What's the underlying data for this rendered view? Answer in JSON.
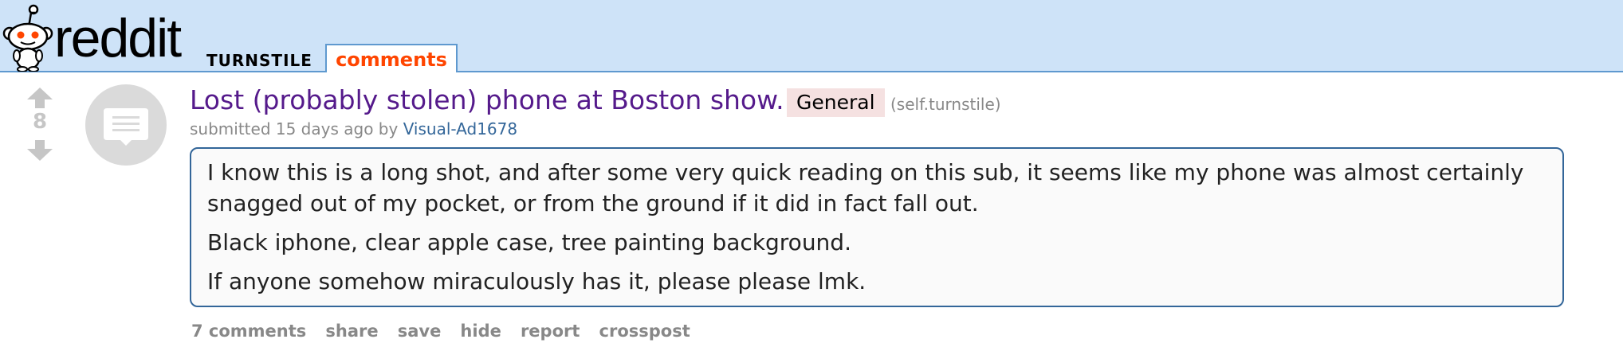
{
  "header": {
    "logo_text": "reddit",
    "subreddit": "TURNSTILE",
    "tab": "comments"
  },
  "post": {
    "score": "8",
    "title": "Lost (probably stolen) phone at Boston show.",
    "flair": "General",
    "domain": "(self.turnstile)",
    "tagline": {
      "prefix": "submitted",
      "time": "15 days ago",
      "by": "by",
      "author": "Visual-Ad1678"
    },
    "selftext": [
      "I know this is a long shot, and after some very quick reading on this sub, it seems like my phone was almost certainly snagged out of my pocket, or from the ground if it did in fact fall out.",
      "Black iphone, clear apple case, tree painting background.",
      "If anyone somehow miraculously has it, please please lmk."
    ],
    "buttons": {
      "comments": "7 comments",
      "share": "share",
      "save": "save",
      "hide": "hide",
      "report": "report",
      "crosspost": "crosspost"
    }
  },
  "colors": {
    "header_bg": "#cee3f8",
    "title": "#551a8b",
    "tab_active": "#ff4500",
    "author": "#336699"
  },
  "icons": [
    "snoo-icon",
    "upvote-arrow-icon",
    "downvote-arrow-icon",
    "self-post-thumbnail-icon"
  ]
}
